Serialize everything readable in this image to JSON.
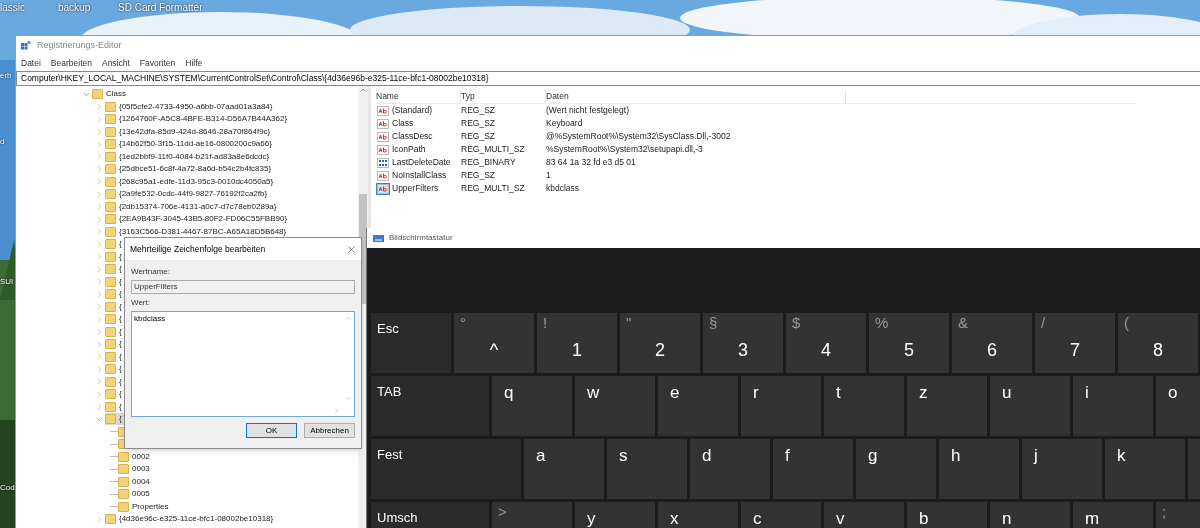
{
  "desktop": {
    "icons": [
      {
        "label": "lassic"
      },
      {
        "label": "backup"
      },
      {
        "label": "SD Card Formatter"
      }
    ],
    "edge_labels": [
      "erb",
      "d",
      "SUI",
      "Cod"
    ]
  },
  "regedit": {
    "title": "Registrierungs-Editor",
    "menu": [
      "Datei",
      "Bearbeiten",
      "Ansicht",
      "Favoriten",
      "Hilfe"
    ],
    "address": "Computer\\HKEY_LOCAL_MACHINE\\SYSTEM\\CurrentControlSet\\Control\\Class\\{4d36e96b-e325-11ce-bfc1-08002be10318}",
    "tree": [
      {
        "label": "Class",
        "expanded": true,
        "selected": false,
        "children": [
          {
            "label": "{05f5cfe2-4733-4950-a6bb-07aad01a3a84}",
            "expanded": false,
            "selected": false
          },
          {
            "label": "{1264760F-A5C8-4BFE-B314-D56A7B44A362}",
            "expanded": false,
            "selected": false
          },
          {
            "label": "{13e42dfa-85d9-424d-8646-28a70f864f9c}",
            "expanded": false,
            "selected": false
          },
          {
            "label": "{14b62f50-3f15-11dd-ae16-0800200c9a66}",
            "expanded": false,
            "selected": false
          },
          {
            "label": "{1ed2bbf9-11f0-4084-b21f-ad83a8e6dcdc}",
            "expanded": false,
            "selected": false
          },
          {
            "label": "{25dbce51-6c8f-4a72-8a6d-b54c2b4fc835}",
            "expanded": false,
            "selected": false
          },
          {
            "label": "{268c95a1-edfe-11d3-95c3-0010dc4050a5}",
            "expanded": false,
            "selected": false
          },
          {
            "label": "{2a9fe532-0cdc-44f9-9827-76192f2ca2fb}",
            "expanded": false,
            "selected": false
          },
          {
            "label": "{2db15374-706e-4131-a0c7-d7c78eb0289a}",
            "expanded": false,
            "selected": false
          },
          {
            "label": "{2EA9B43F-3045-43B5-80F2-FD06C55FBB90}",
            "expanded": false,
            "selected": false
          },
          {
            "label": "{3163C566-D381-4467-87BC-A65A18D5B648}",
            "expanded": false,
            "selected": false
          },
          {
            "label": "{",
            "expanded": false,
            "selected": false
          },
          {
            "label": "{",
            "expanded": false,
            "selected": false
          },
          {
            "label": "{",
            "expanded": false,
            "selected": false
          },
          {
            "label": "{",
            "expanded": false,
            "selected": false
          },
          {
            "label": "{",
            "expanded": false,
            "selected": false
          },
          {
            "label": "{",
            "expanded": false,
            "selected": false
          },
          {
            "label": "{",
            "expanded": false,
            "selected": false
          },
          {
            "label": "{",
            "expanded": false,
            "selected": false
          },
          {
            "label": "{",
            "expanded": false,
            "selected": false
          },
          {
            "label": "{",
            "expanded": false,
            "selected": false
          },
          {
            "label": "{",
            "expanded": false,
            "selected": false
          },
          {
            "label": "{",
            "expanded": false,
            "selected": false
          },
          {
            "label": "{",
            "expanded": false,
            "selected": false
          },
          {
            "label": "{",
            "expanded": false,
            "selected": false
          },
          {
            "label": "{",
            "expanded": true,
            "selected": true,
            "children": [
              {
                "selected": false
              },
              {
                "selected": false
              },
              {
                "label": "0002",
                "selected": false
              },
              {
                "label": "0003",
                "selected": false
              },
              {
                "label": "0004",
                "selected": false
              },
              {
                "label": "0005",
                "selected": false
              },
              {
                "label": "Properties",
                "selected": false
              }
            ]
          },
          {
            "label": "{4d36e96c-e325-11ce-bfc1-08002be10318}",
            "expanded": false,
            "selected": false
          }
        ]
      }
    ],
    "columns": [
      "Name",
      "Typ",
      "Daten"
    ],
    "values": [
      {
        "kind": "string",
        "name": "(Standard)",
        "type": "REG_SZ",
        "data": "(Wert nicht festgelegt)",
        "selected": false
      },
      {
        "kind": "string",
        "name": "Class",
        "type": "REG_SZ",
        "data": "Keyboard",
        "selected": false
      },
      {
        "kind": "string",
        "name": "ClassDesc",
        "type": "REG_SZ",
        "data": "@%SystemRoot%\\System32\\SysClass.Dll,-3002",
        "selected": false
      },
      {
        "kind": "string",
        "name": "IconPath",
        "type": "REG_MULTI_SZ",
        "data": "%SystemRoot%\\System32\\setupapi.dll,-3",
        "selected": false
      },
      {
        "kind": "binary",
        "name": "LastDeleteDate",
        "type": "REG_BINARY",
        "data": "83 64 1a 32 fd e3 d5 01",
        "selected": false
      },
      {
        "kind": "string",
        "name": "NoInstallClass",
        "type": "REG_SZ",
        "data": "1",
        "selected": false
      },
      {
        "kind": "string",
        "name": "UpperFilters",
        "type": "REG_MULTI_SZ",
        "data": "kbdclass",
        "selected": true
      }
    ]
  },
  "dialog": {
    "title": "Mehrteilige Zeichenfolge bearbeiten",
    "name_label": "Wertname:",
    "name_value": "UpperFilters",
    "data_label": "Wert:",
    "data_value": "kbdclass",
    "buttons": [
      "OK",
      "Abbrechen"
    ]
  },
  "keyboard": {
    "title": "Bildschirmtastatur",
    "rows": [
      [
        {
          "kind": "esc",
          "label": "Esc"
        },
        {
          "kind": "char",
          "shift": "°",
          "label": "^"
        },
        {
          "kind": "char",
          "shift": "!",
          "label": "1"
        },
        {
          "kind": "char",
          "shift": "\"",
          "label": "2"
        },
        {
          "kind": "char",
          "shift": "§",
          "label": "3"
        },
        {
          "kind": "char",
          "shift": "$",
          "label": "4"
        },
        {
          "kind": "char",
          "shift": "%",
          "label": "5"
        },
        {
          "kind": "char",
          "shift": "&",
          "label": "6"
        },
        {
          "kind": "char",
          "shift": "/",
          "label": "7"
        },
        {
          "kind": "char",
          "shift": "(",
          "label": "8"
        }
      ],
      [
        {
          "kind": "tab",
          "label": "TAB"
        },
        {
          "kind": "char",
          "label": "q"
        },
        {
          "kind": "char",
          "label": "w"
        },
        {
          "kind": "char",
          "label": "e"
        },
        {
          "kind": "char",
          "label": "r"
        },
        {
          "kind": "char",
          "label": "t"
        },
        {
          "kind": "char",
          "label": "z"
        },
        {
          "kind": "char",
          "label": "u"
        },
        {
          "kind": "char",
          "label": "i"
        },
        {
          "kind": "char",
          "label": "o"
        }
      ],
      [
        {
          "kind": "caps",
          "label": "Fest"
        },
        {
          "kind": "char",
          "label": "a"
        },
        {
          "kind": "char",
          "label": "s"
        },
        {
          "kind": "char",
          "label": "d"
        },
        {
          "kind": "char",
          "label": "f"
        },
        {
          "kind": "char",
          "label": "g"
        },
        {
          "kind": "char",
          "label": "h"
        },
        {
          "kind": "char",
          "label": "j"
        },
        {
          "kind": "char",
          "label": "k"
        },
        {
          "kind": "char"
        }
      ],
      [
        {
          "kind": "shift",
          "label": "Umsch"
        },
        {
          "kind": "char",
          "shift": ">"
        },
        {
          "kind": "char",
          "label": "y"
        },
        {
          "kind": "char",
          "label": "x"
        },
        {
          "kind": "char",
          "label": "c"
        },
        {
          "kind": "char",
          "label": "v"
        },
        {
          "kind": "char",
          "label": "b"
        },
        {
          "kind": "char",
          "label": "n"
        },
        {
          "kind": "char",
          "label": "m"
        },
        {
          "kind": "char",
          "shift": ";"
        }
      ]
    ]
  }
}
